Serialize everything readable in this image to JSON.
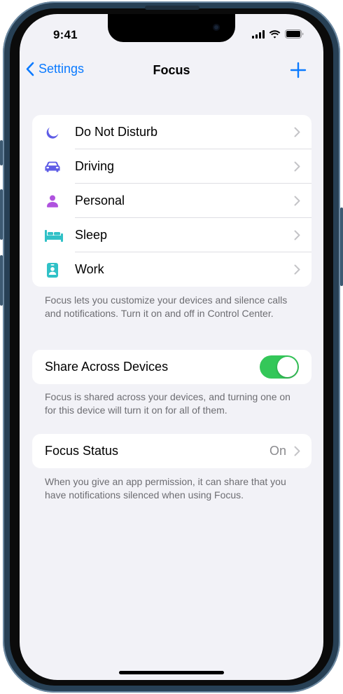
{
  "status_bar": {
    "time": "9:41"
  },
  "nav": {
    "back_label": "Settings",
    "title": "Focus",
    "add_icon": "plus-icon"
  },
  "focus_modes": [
    {
      "label": "Do Not Disturb",
      "icon": "moon-icon",
      "color": "#5e5ce6"
    },
    {
      "label": "Driving",
      "icon": "car-icon",
      "color": "#5e5ce6"
    },
    {
      "label": "Personal",
      "icon": "person-icon",
      "color": "#af52de"
    },
    {
      "label": "Sleep",
      "icon": "bed-icon",
      "color": "#30c1c7"
    },
    {
      "label": "Work",
      "icon": "id-badge-icon",
      "color": "#30c1c7"
    }
  ],
  "focus_footnote": "Focus lets you customize your devices and silence calls and notifications. Turn it on and off in Control Center.",
  "share": {
    "label": "Share Across Devices",
    "enabled": true,
    "toggle_color": "#34c759"
  },
  "share_footnote": "Focus is shared across your devices, and turning one on for this device will turn it on for all of them.",
  "focus_status": {
    "label": "Focus Status",
    "value": "On"
  },
  "status_footnote": "When you give an app permission, it can share that you have notifications silenced when using Focus.",
  "colors": {
    "accent": "#0a7aff",
    "background": "#f2f2f7"
  }
}
